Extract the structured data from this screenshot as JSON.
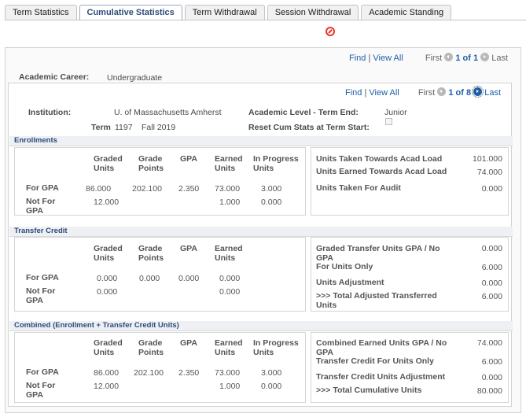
{
  "tabs": [
    {
      "label": "Term Statistics"
    },
    {
      "label": "Cumulative Statistics"
    },
    {
      "label": "Term Withdrawal"
    },
    {
      "label": "Session Withdrawal"
    },
    {
      "label": "Academic Standing"
    }
  ],
  "outer_nav": {
    "find": "Find",
    "sep": "|",
    "view_all": "View All",
    "first": "First",
    "count": "1 of 1",
    "last": "Last"
  },
  "academic_career": {
    "label": "Academic Career:",
    "value": "Undergraduate"
  },
  "inner_nav": {
    "find": "Find",
    "sep": "|",
    "view_all": "View All",
    "first": "First",
    "count": "1 of 8",
    "last": "Last"
  },
  "institution": {
    "label": "Institution:",
    "value": "U. of Massachusetts Amherst"
  },
  "academic_level": {
    "label": "Academic Level - Term End:",
    "value": "Junior"
  },
  "term": {
    "label": "Term",
    "code": "1197",
    "name": "Fall 2019"
  },
  "reset_cum": {
    "label": "Reset Cum Stats at Term Start:",
    "checked": false
  },
  "enrollments": {
    "title": "Enrollments",
    "headers": {
      "graded": "Graded Units",
      "points": "Grade Points",
      "gpa": "GPA",
      "earned": "Earned Units",
      "inprog": "In Progress Units"
    },
    "rows": [
      {
        "label": "For GPA",
        "graded": "86.000",
        "points": "202.100",
        "gpa": "2.350",
        "earned": "73.000",
        "inprog": "3.000"
      },
      {
        "label": "Not For GPA",
        "graded": "12.000",
        "points": "",
        "gpa": "",
        "earned": "1.000",
        "inprog": "0.000"
      }
    ],
    "right": [
      {
        "label": "Units Taken Towards Acad Load",
        "value": "101.000"
      },
      {
        "label": "Units Earned Towards Acad Load",
        "value": "74.000"
      },
      {
        "label": "Units Taken For Audit",
        "value": "0.000"
      }
    ]
  },
  "transfer": {
    "title": "Transfer Credit",
    "headers": {
      "graded": "Graded Units",
      "points": "Grade Points",
      "gpa": "GPA",
      "earned": "Earned Units"
    },
    "rows": [
      {
        "label": "For GPA",
        "graded": "0.000",
        "points": "0.000",
        "gpa": "0.000",
        "earned": "0.000"
      },
      {
        "label": "Not For GPA",
        "graded": "0.000",
        "points": "",
        "gpa": "",
        "earned": "0.000"
      }
    ],
    "right": [
      {
        "label": "Graded Transfer Units GPA / No GPA",
        "value": "0.000"
      },
      {
        "label": "For Units Only",
        "value": "6.000"
      },
      {
        "label": "Units Adjustment",
        "value": "0.000"
      },
      {
        "label": ">>> Total Adjusted Transferred Units",
        "value": "6.000"
      }
    ]
  },
  "combined": {
    "title": "Combined (Enrollment + Transfer Credit Units)",
    "headers": {
      "graded": "Graded Units",
      "points": "Grade Points",
      "gpa": "GPA",
      "earned": "Earned Units",
      "inprog": "In Progress Units"
    },
    "rows": [
      {
        "label": "For GPA",
        "graded": "86.000",
        "points": "202.100",
        "gpa": "2.350",
        "earned": "73.000",
        "inprog": "3.000"
      },
      {
        "label": "Not For GPA",
        "graded": "12.000",
        "points": "",
        "gpa": "",
        "earned": "1.000",
        "inprog": "0.000"
      }
    ],
    "right": [
      {
        "label": "Combined Earned Units GPA / No GPA",
        "value": "74.000"
      },
      {
        "label": "Transfer Credit For Units Only",
        "value": "6.000"
      },
      {
        "label": "Transfer Credit Units Adjustment",
        "value": "0.000"
      },
      {
        "label": ">>> Total Cumulative Units",
        "value": "80.000"
      }
    ]
  }
}
